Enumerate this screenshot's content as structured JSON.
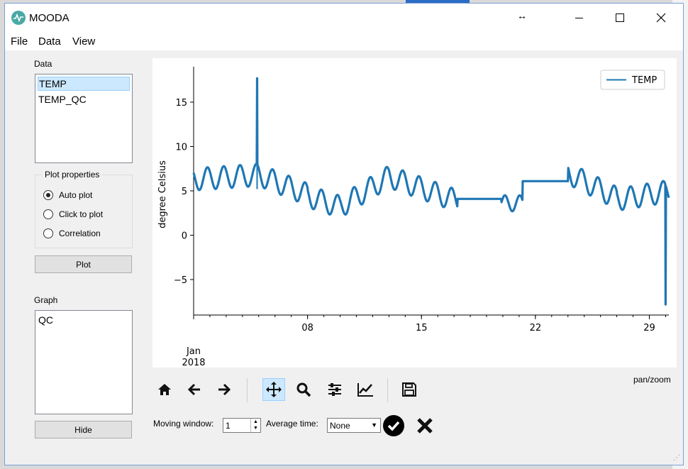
{
  "window": {
    "title": "MOODA",
    "resize_cursor": "↔"
  },
  "menu": [
    "File",
    "Data",
    "View"
  ],
  "sidebar": {
    "data_label": "Data",
    "data_items": [
      "TEMP",
      "TEMP_QC"
    ],
    "plot_properties_label": "Plot properties",
    "plot_options": [
      {
        "label": "Auto plot",
        "checked": true
      },
      {
        "label": "Click to plot",
        "checked": false
      },
      {
        "label": "Correlation",
        "checked": false
      }
    ],
    "plot_button": "Plot",
    "graph_label": "Graph",
    "graph_items": [
      "QC"
    ],
    "hide_button": "Hide"
  },
  "toolbar": {
    "icons": [
      "home-icon",
      "back-arrow-icon",
      "forward-arrow-icon",
      "pan-icon",
      "zoom-icon",
      "subplots-icon",
      "edit-axes-icon",
      "save-icon"
    ],
    "active": "pan-icon",
    "mode_label": "pan/zoom"
  },
  "controls": {
    "moving_window_label": "Moving window:",
    "moving_window_value": "1",
    "average_time_label": "Average time:",
    "average_time_value": "None"
  },
  "chart_data": {
    "type": "line",
    "series": [
      {
        "name": "TEMP",
        "color": "#1f77b4"
      }
    ],
    "ylabel": "degree Celsius",
    "xlabel": "",
    "x_ticks": [
      "08",
      "15",
      "22",
      "29"
    ],
    "x_tick_days": [
      8,
      15,
      22,
      29
    ],
    "x_sublabel": [
      "Jan",
      "2018"
    ],
    "y_ticks": [
      15,
      10,
      5,
      0,
      -5
    ],
    "xlim_days": [
      1,
      30.2
    ],
    "ylim": [
      -9,
      19
    ],
    "legend": "top-right",
    "spike_max": {
      "day": 4.9,
      "value": 17.7
    },
    "spike_min": {
      "day": 30,
      "value": -7.8
    }
  }
}
